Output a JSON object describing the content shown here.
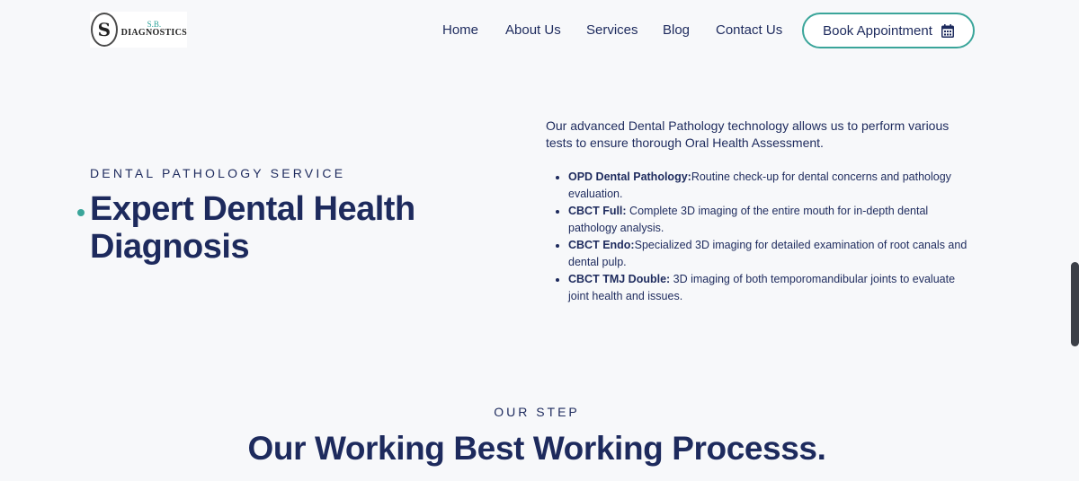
{
  "logo": {
    "monogram": "S",
    "line1": "S.B.",
    "line2": "DIAGNOSTICS"
  },
  "nav": {
    "items": [
      "Home",
      "About Us",
      "Services",
      "Blog",
      "Contact Us"
    ],
    "cta_label": "Book Appointment",
    "cta_icon": "calendar-icon"
  },
  "hero": {
    "eyebrow": "DENTAL PATHOLOGY SERVICE",
    "title": "Expert Dental Health Diagnosis",
    "accent_color": "#3aa59a"
  },
  "details": {
    "intro": "Our advanced Dental Pathology technology allows us to perform various tests to ensure thorough Oral Health Assessment.",
    "services": [
      {
        "name": "OPD Dental Pathology:",
        "desc": "Routine check-up for dental concerns and pathology evaluation."
      },
      {
        "name": "CBCT Full:",
        "desc": " Complete 3D imaging of the entire mouth for in-depth dental pathology analysis."
      },
      {
        "name": "CBCT Endo:",
        "desc": "Specialized 3D imaging for detailed examination of root canals and dental pulp."
      },
      {
        "name": "CBCT TMJ Double:",
        "desc": " 3D imaging of both temporomandibular joints to evaluate joint health and issues."
      }
    ]
  },
  "steps": {
    "eyebrow": "OUR STEP",
    "title": "Our Working Best Working Processs."
  },
  "colors": {
    "text": "#1d2a5d",
    "accent": "#3aa59a",
    "background": "#f7f8fa"
  }
}
